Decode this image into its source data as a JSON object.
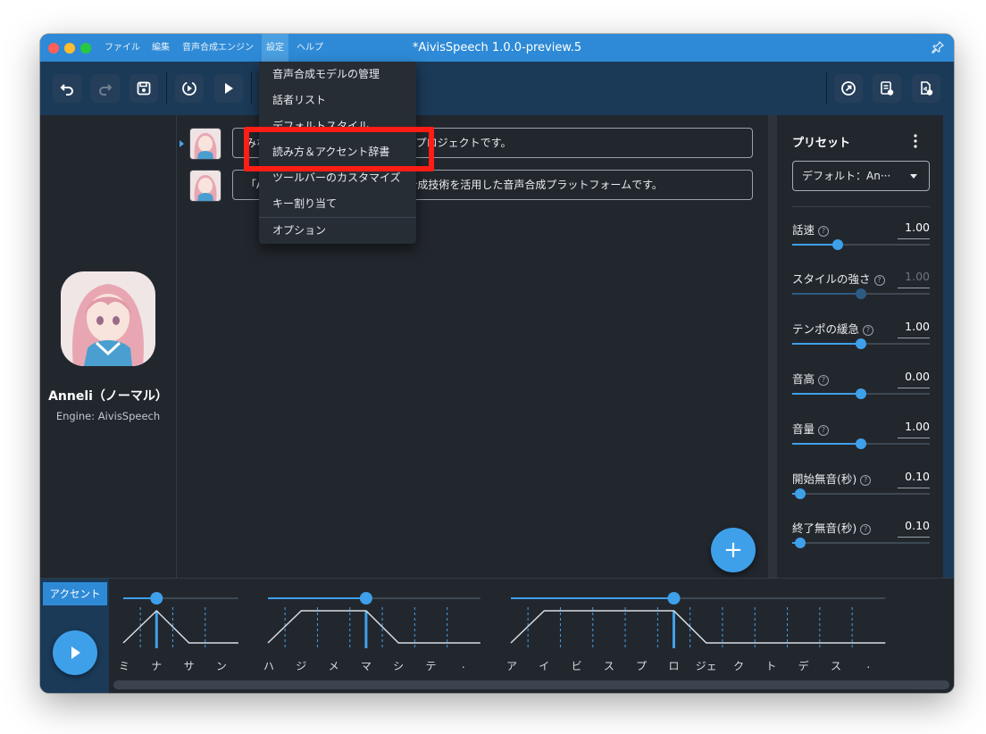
{
  "window": {
    "title": "*AivisSpeech 1.0.0-preview.5"
  },
  "menubar": {
    "items": [
      "ファイル",
      "編集",
      "音声合成エンジン",
      "設定",
      "ヘルプ"
    ]
  },
  "settings_menu": {
    "items": [
      "音声合成モデルの管理",
      "話者リスト",
      "デフォルトスタイル",
      "読み方＆アクセント辞書",
      "ツールバーのカスタマイズ",
      "キー割り当て",
      "オプション"
    ]
  },
  "character": {
    "name": "Anneli（ノーマル）",
    "engine": "Engine: AivisSpeech"
  },
  "lines": [
    {
      "text": "みなさん、はじめまして。アイビスプロジェクトです。"
    },
    {
      "text": "「AivisSpeech」は、最新の音声合成技術を活用した音声合成プラットフォームです。"
    }
  ],
  "add_button": "+",
  "presets": {
    "title": "プリセット",
    "selected": "デフォルト：An···",
    "params": [
      {
        "label": "話速",
        "value": "1.00",
        "ratio": 0.33,
        "dim": false
      },
      {
        "label": "スタイルの強さ",
        "value": "1.00",
        "ratio": 0.5,
        "dim": true
      },
      {
        "label": "テンポの緩急",
        "value": "1.00",
        "ratio": 0.5,
        "dim": false
      },
      {
        "label": "音高",
        "value": "0.00",
        "ratio": 0.5,
        "dim": false
      },
      {
        "label": "音量",
        "value": "1.00",
        "ratio": 0.5,
        "dim": false
      },
      {
        "label": "開始無音(秒)",
        "value": "0.10",
        "ratio": 0.06,
        "dim": false
      },
      {
        "label": "終了無音(秒)",
        "value": "0.10",
        "ratio": 0.06,
        "dim": false
      }
    ]
  },
  "accent": {
    "tab": "アクセント",
    "phrases": [
      {
        "mora": [
          "ミ",
          "ナ",
          "サ",
          "ン"
        ],
        "accent": 2
      },
      {
        "mora": [
          "ハ",
          "ジ",
          "メ",
          "マ",
          "シ",
          "テ",
          "."
        ],
        "accent": 4
      },
      {
        "mora": [
          "ア",
          "イ",
          "ビ",
          "ス",
          "プ",
          "ロ",
          "ジェ",
          "ク",
          "ト",
          "デ",
          "ス",
          "."
        ],
        "accent": 6
      }
    ]
  },
  "colors": {
    "accent": "#3fa0ea",
    "titlebar": "#2e8ad6",
    "toolbar": "#1b3a58",
    "highlight": "#ff1d15"
  }
}
